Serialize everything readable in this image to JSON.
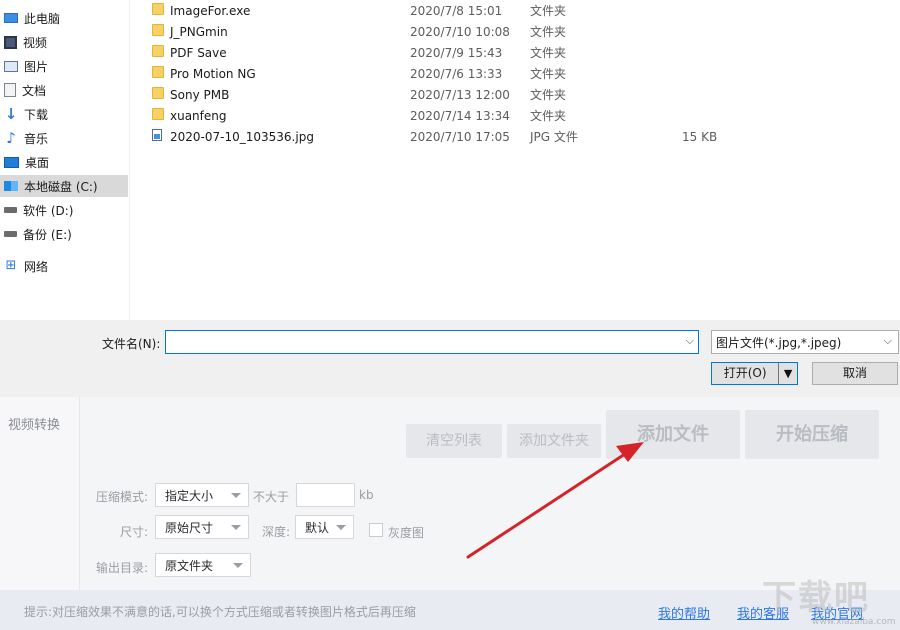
{
  "nav": {
    "items": [
      {
        "label": "此电脑",
        "icon": "computer-icon"
      },
      {
        "label": "视频",
        "icon": "video-folder-icon"
      },
      {
        "label": "图片",
        "icon": "pictures-folder-icon"
      },
      {
        "label": "文档",
        "icon": "documents-folder-icon"
      },
      {
        "label": "下载",
        "icon": "downloads-arrow-icon"
      },
      {
        "label": "音乐",
        "icon": "music-note-icon"
      },
      {
        "label": "桌面",
        "icon": "desktop-icon"
      },
      {
        "label": "本地磁盘 (C:)",
        "icon": "windows-drive-icon",
        "selected": true
      },
      {
        "label": "软件 (D:)",
        "icon": "drive-icon"
      },
      {
        "label": "备份 (E:)",
        "icon": "drive-icon"
      },
      {
        "label": "网络",
        "icon": "network-icon"
      }
    ]
  },
  "files": [
    {
      "name": "ImageFor.exe",
      "date": "2020/7/8 15:01",
      "type": "文件夹",
      "size": "",
      "icon": "folder-icon"
    },
    {
      "name": "J_PNGmin",
      "date": "2020/7/10 10:08",
      "type": "文件夹",
      "size": "",
      "icon": "folder-icon"
    },
    {
      "name": "PDF Save",
      "date": "2020/7/9 15:43",
      "type": "文件夹",
      "size": "",
      "icon": "folder-icon"
    },
    {
      "name": "Pro Motion NG",
      "date": "2020/7/6 13:33",
      "type": "文件夹",
      "size": "",
      "icon": "folder-icon"
    },
    {
      "name": "Sony PMB",
      "date": "2020/7/13 12:00",
      "type": "文件夹",
      "size": "",
      "icon": "folder-icon"
    },
    {
      "name": "xuanfeng",
      "date": "2020/7/14 13:34",
      "type": "文件夹",
      "size": "",
      "icon": "folder-icon"
    },
    {
      "name": "2020-07-10_103536.jpg",
      "date": "2020/7/10 17:05",
      "type": "JPG 文件",
      "size": "15 KB",
      "icon": "jpg-file-icon"
    }
  ],
  "dialog": {
    "filename_label": "文件名(N):",
    "filename_value": "",
    "filetype_value": "图片文件(*.jpg,*.jpeg)",
    "open_label": "打开(O)",
    "cancel_label": "取消"
  },
  "app": {
    "sidebar_item": "视频转换",
    "buttons": {
      "clear_list": "清空列表",
      "add_folder": "添加文件夹",
      "add_file": "添加文件",
      "start_compress": "开始压缩"
    },
    "form": {
      "mode_label": "压缩模式:",
      "mode_value": "指定大小",
      "max_label": "不大于",
      "max_value": "",
      "kb_unit": "kb",
      "size_label": "尺寸:",
      "size_value": "原始尺寸",
      "depth_label": "深度:",
      "depth_value": "默认",
      "gray_label": "灰度图",
      "gray_checked": false,
      "output_label": "输出目录:",
      "output_value": "原文件夹"
    },
    "footer": {
      "tip": "提示:对压缩效果不满意的话,可以换个方式压缩或者转换图片格式后再压缩",
      "help": "我的帮助",
      "support": "我的客服",
      "website": "我的官网"
    }
  },
  "annotation": {
    "arrow_color": "#d4242a"
  },
  "watermark": {
    "text": "下载吧",
    "sub": "www.xiazaiba.com"
  }
}
